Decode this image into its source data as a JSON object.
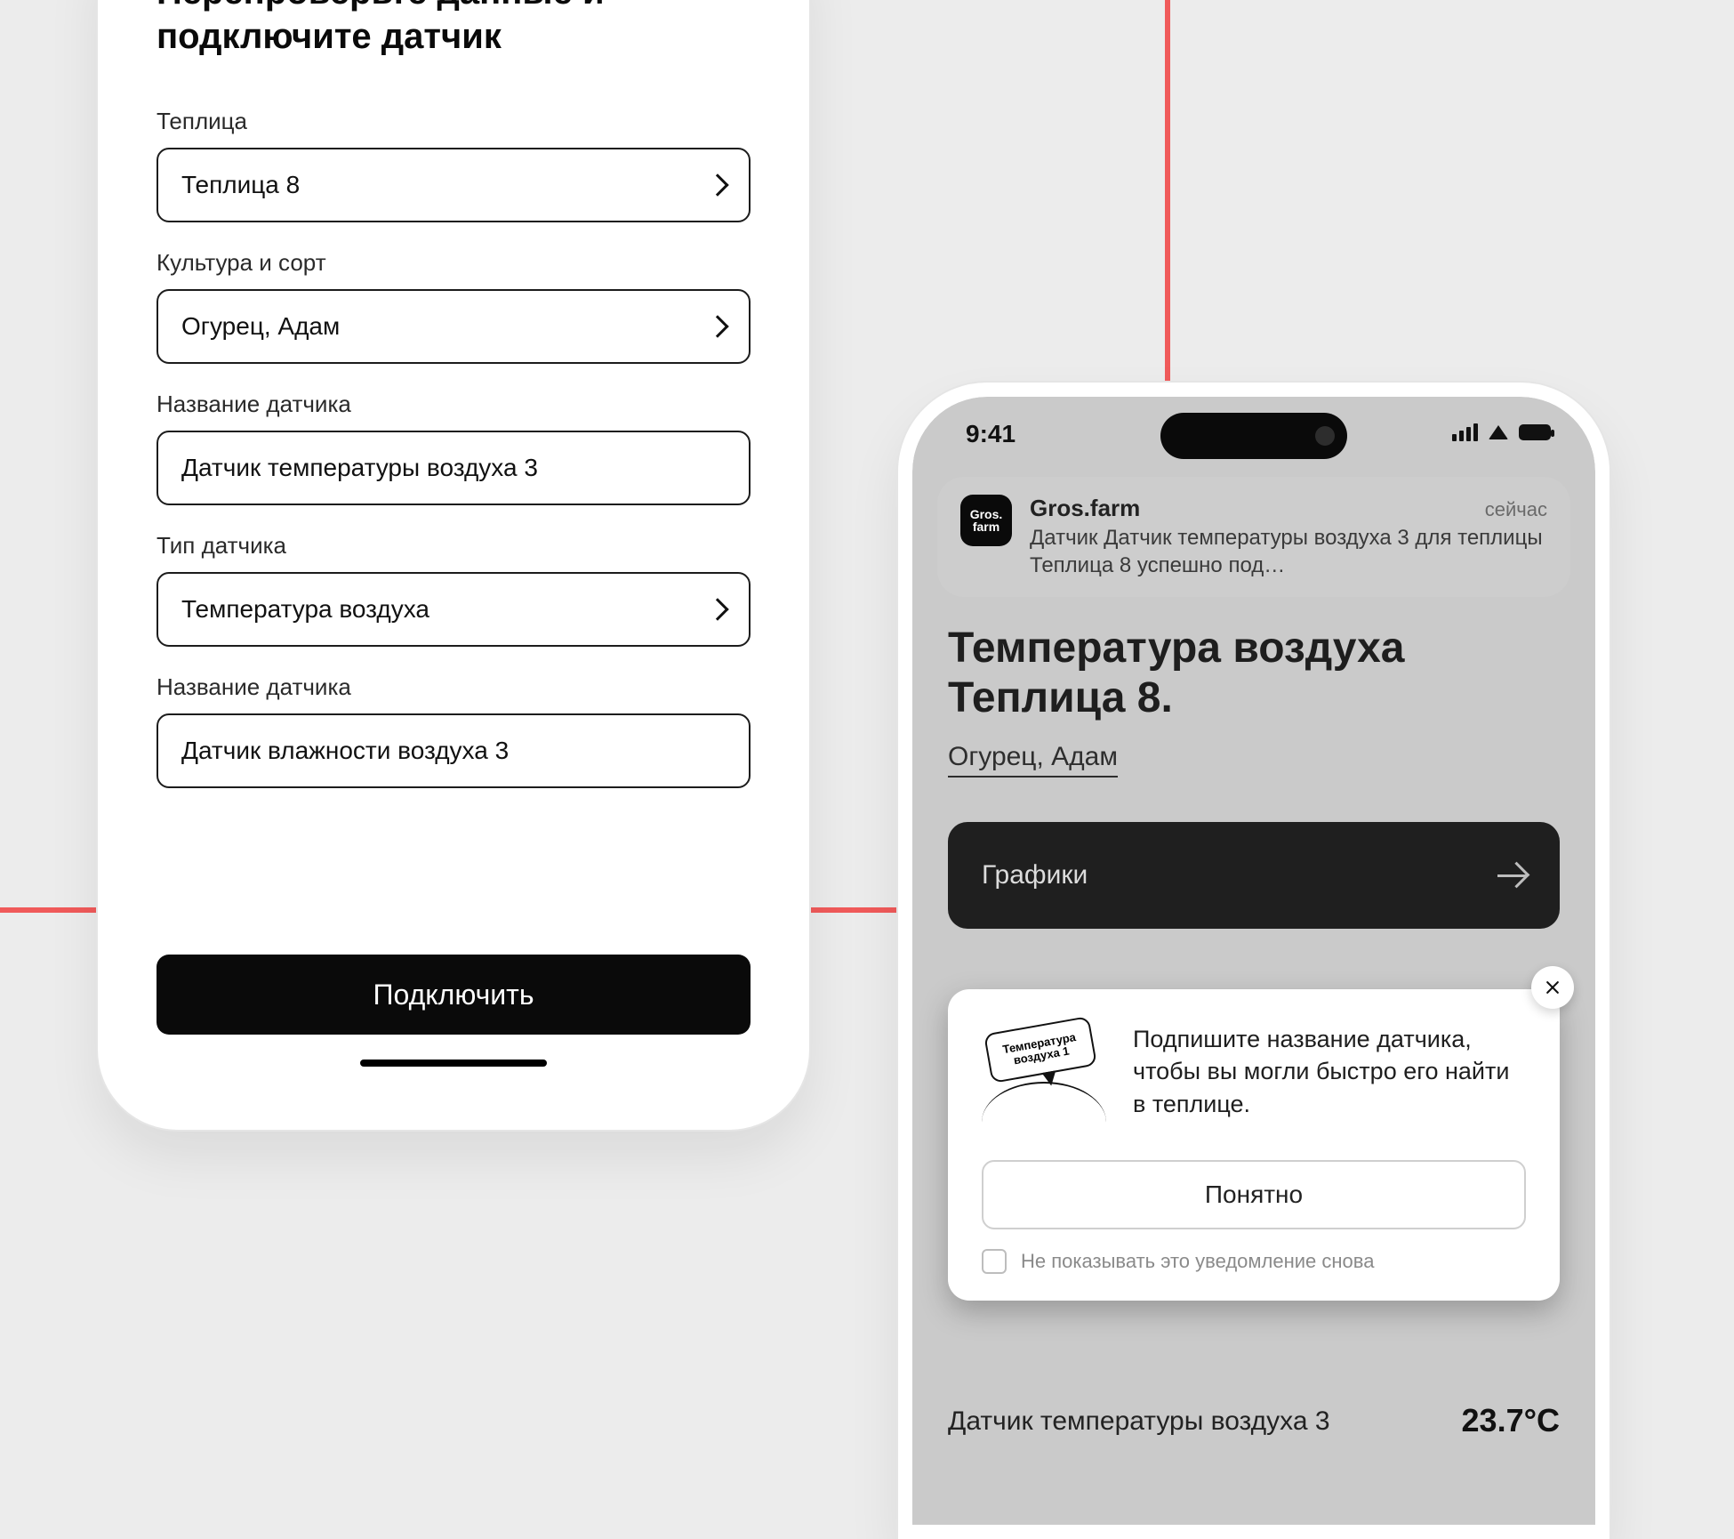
{
  "phone1": {
    "title": "Перепроверьте данные и подключите датчик",
    "fields": [
      {
        "label": "Теплица",
        "value": "Теплица 8",
        "hasChevron": true
      },
      {
        "label": "Культура и сорт",
        "value": "Огурец, Адам",
        "hasChevron": true
      },
      {
        "label": "Название датчика",
        "value": "Датчик температуры воздуха 3",
        "hasChevron": false
      },
      {
        "label": "Тип датчика",
        "value": "Температура воздуха",
        "hasChevron": true
      },
      {
        "label": "Название датчика",
        "value": "Датчик влажности воздуха 3",
        "hasChevron": false
      }
    ],
    "connect": "Подключить"
  },
  "phone2": {
    "time": "9:41",
    "push": {
      "app": "Gros.farm",
      "iconText": "Gros.\nfarm",
      "when": "сейчас",
      "msg": "Датчик Датчик температуры воздуха 3 для теплицы Теплица 8 успешно под…"
    },
    "title": "Температура воздуха Теплица 8.",
    "subtitle": "Огурец, Адам",
    "chartsLabel": "Графики",
    "tip": {
      "tag": "Температура воздуха 1",
      "text": "Подпишите название датчика, чтобы вы могли быстро его найти в теплице.",
      "ok": "Понятно",
      "dontShow": "Не показывать это уведомление снова"
    },
    "sensor": {
      "name": "Датчик температуры воздуха 3",
      "value": "23.7°C"
    }
  }
}
